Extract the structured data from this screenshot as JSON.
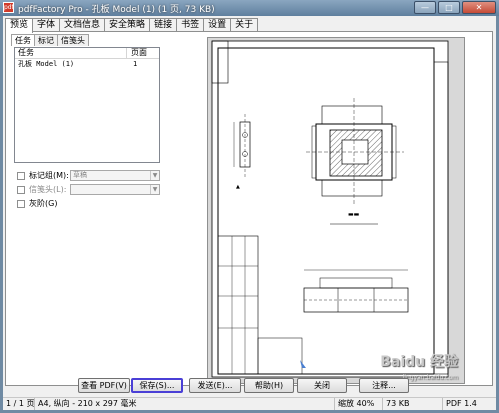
{
  "window": {
    "app_icon": "pdf",
    "title": "pdfFactory Pro - 孔板 Model (1) (1 页, 73 KB)",
    "controls": [
      "—",
      "□",
      "✕"
    ]
  },
  "tabs": [
    "预览",
    "字体",
    "文档信息",
    "安全策略",
    "链接",
    "书签",
    "设置",
    "关于"
  ],
  "subtabs": [
    "任务",
    "标记",
    "信笺头"
  ],
  "task_table": {
    "headers": [
      "任务",
      "页面"
    ],
    "rows": [
      {
        "name": "孔板 Model (1)",
        "pages": "1"
      }
    ]
  },
  "options": {
    "markup_group": {
      "label": "标记组(M):",
      "value": "草稿"
    },
    "letterhead": {
      "label": "信笺头(L):",
      "value": ""
    },
    "grayscale": {
      "label": "灰阶(G)"
    }
  },
  "buttons": {
    "view_pdf": "查看 PDF(V)",
    "save": "保存(S)...",
    "send": "发送(E)...",
    "help": "帮助(H)",
    "close": "关闭",
    "extra": "注释..."
  },
  "status": {
    "page": "1 / 1 页",
    "paper": "A4, 纵向 - 210 x 297 毫米",
    "zoom": "缩放 40%",
    "size": "73 KB",
    "pdf_version": "PDF 1.4"
  },
  "watermark": {
    "line1": "Baidu 经验",
    "line2": "jingyan.baidu.com"
  }
}
